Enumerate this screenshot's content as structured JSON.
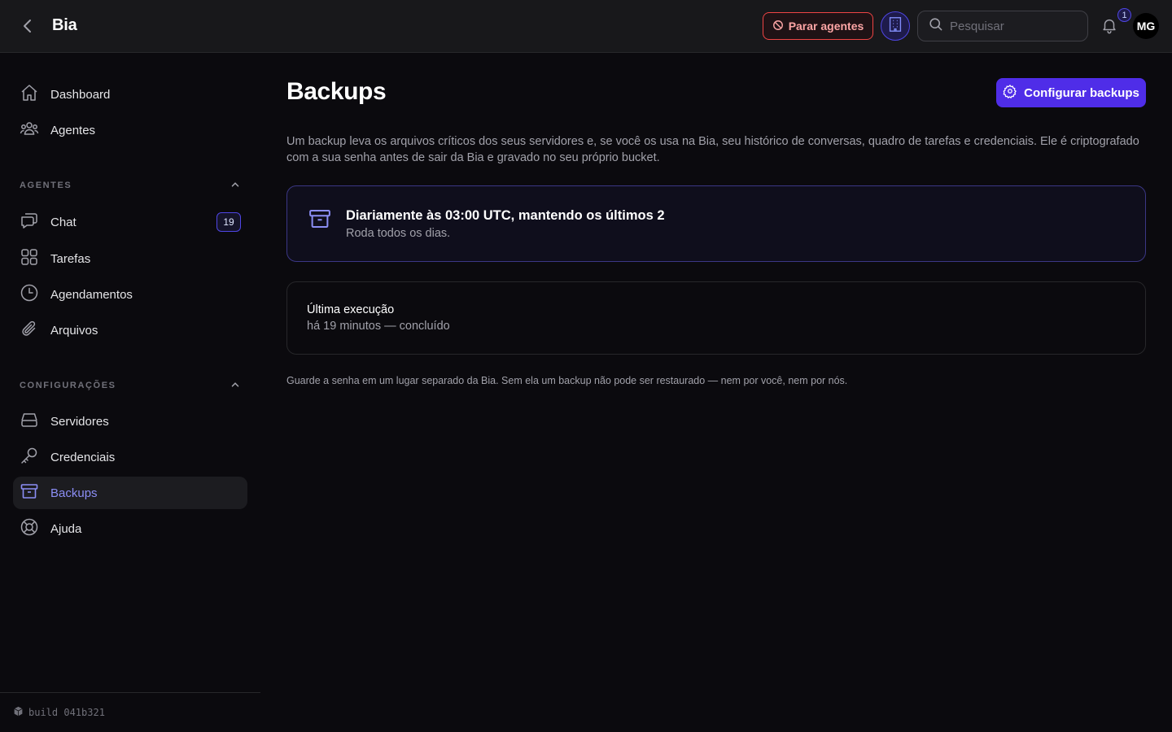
{
  "header": {
    "title": "Bia",
    "stop_label": "Parar agentes",
    "search_placeholder": "Pesquisar",
    "notification_count": "1",
    "avatar_initials": "MG"
  },
  "sidebar": {
    "top_items": [
      {
        "label": "Dashboard",
        "icon": "home-icon"
      },
      {
        "label": "Agentes",
        "icon": "users-icon"
      }
    ],
    "agents_section": {
      "heading": "AGENTES",
      "items": [
        {
          "label": "Chat",
          "icon": "chat-icon",
          "badge": "19"
        },
        {
          "label": "Tarefas",
          "icon": "grid-icon"
        },
        {
          "label": "Agendamentos",
          "icon": "clock-icon"
        },
        {
          "label": "Arquivos",
          "icon": "paperclip-icon"
        }
      ]
    },
    "config_section": {
      "heading": "CONFIGURAÇÕES",
      "items": [
        {
          "label": "Servidores",
          "icon": "server-icon"
        },
        {
          "label": "Credenciais",
          "icon": "key-icon"
        },
        {
          "label": "Backups",
          "icon": "archive-icon",
          "active": true
        },
        {
          "label": "Ajuda",
          "icon": "lifebuoy-icon"
        }
      ]
    },
    "footer_build": "build 041b321"
  },
  "main": {
    "title": "Backups",
    "config_button": "Configurar backups",
    "intro": "Um backup leva os arquivos críticos dos seus servidores e, se você os usa na Bia, seu histórico de conversas, quadro de tarefas e credenciais. Ele é criptografado com a sua senha antes de sair da Bia e gravado no seu próprio bucket.",
    "schedule": {
      "title": "Diariamente às 03:00 UTC, mantendo os últimos 2",
      "subtitle": "Roda todos os dias."
    },
    "last_run": {
      "label": "Última execução",
      "status": "há 19 minutos — concluído"
    },
    "note": "Guarde a senha em um lugar separado da Bia. Sem ela um backup não pode ser restaurado — nem por você, nem por nós."
  },
  "colors": {
    "accent": "#4f2de8",
    "active_text": "#8b8ef5",
    "danger": "#ef4444",
    "background": "#0b0a0e"
  }
}
